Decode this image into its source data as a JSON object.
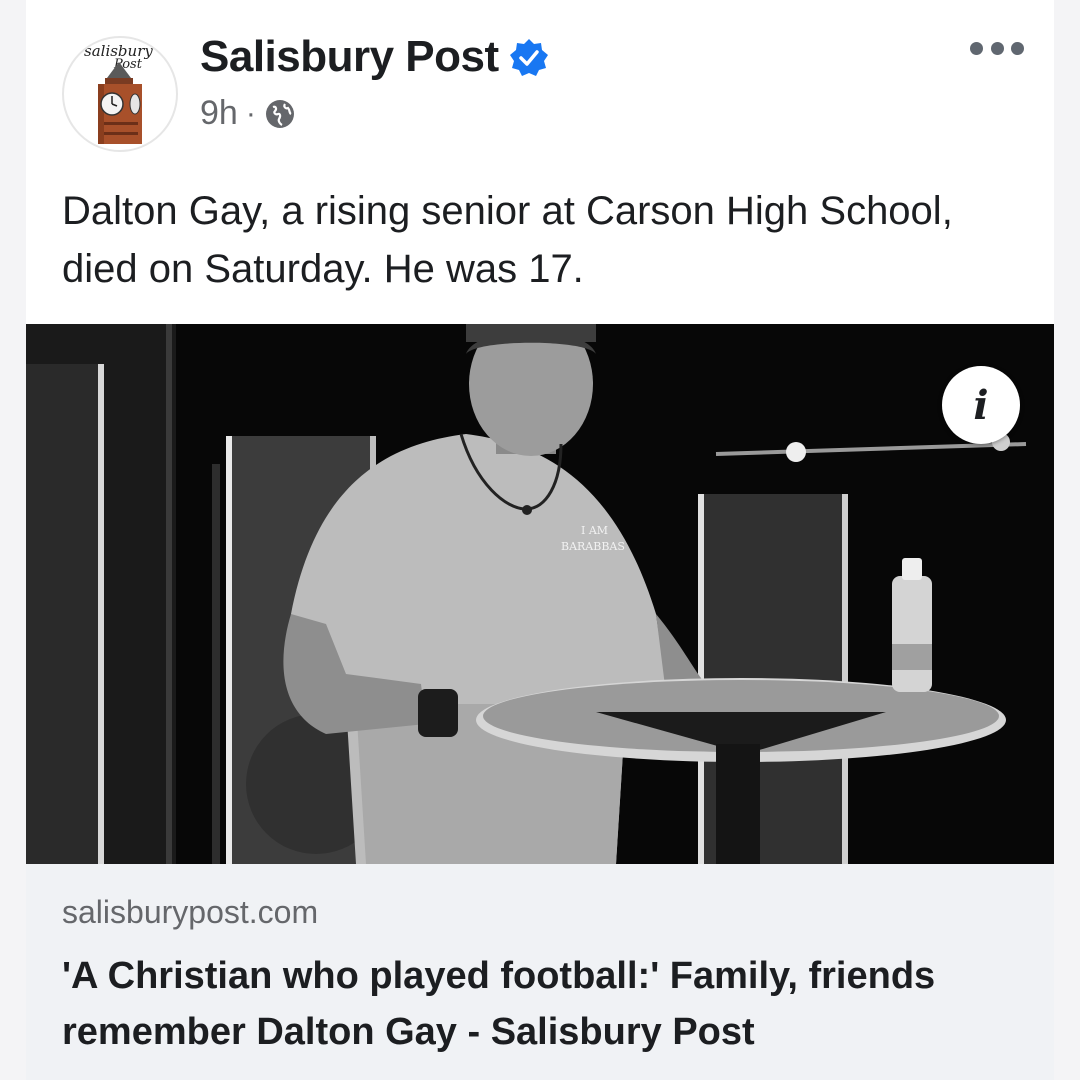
{
  "post": {
    "page_name": "Salisbury Post",
    "verified": true,
    "time": "9h",
    "separator": "·",
    "audience_icon": "globe-icon",
    "text": "Dalton Gay, a rising senior at Carson High School, died on Saturday. He was 17."
  },
  "avatar": {
    "logo_line1": "salisbury",
    "logo_line2": "Post"
  },
  "photo": {
    "info_glyph": "i",
    "shirt_text_line1": "I AM",
    "shirt_text_line2": "BARABBAS"
  },
  "link_preview": {
    "domain": "salisburypost.com",
    "title": "'A Christian who played football:' Family, friends remember Dalton Gay - Salisbury Post"
  },
  "colors": {
    "verified_blue": "#1877f2",
    "secondary_text": "#65676b",
    "link_box_bg": "#f0f2f5"
  }
}
